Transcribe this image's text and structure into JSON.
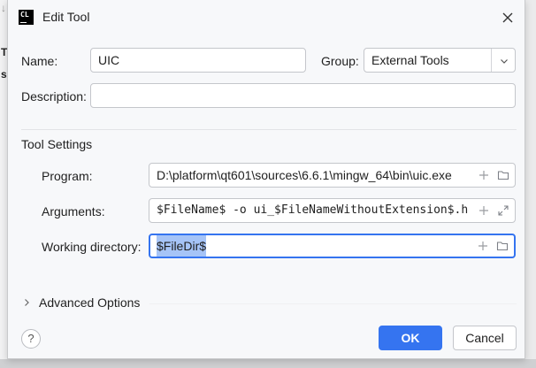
{
  "background": {
    "peek_texts": [
      "T",
      "si"
    ]
  },
  "dialog": {
    "title": "Edit Tool",
    "app_icon_text": "CL",
    "icons": {
      "close": "close-icon",
      "help": "help-icon",
      "add": "plus-icon",
      "browse": "folder-icon",
      "expand": "expand-icon",
      "dropdown": "chevron-down-icon",
      "advanced": "chevron-right-icon"
    }
  },
  "form": {
    "name_label": "Name:",
    "name_value": "UIC",
    "group_label": "Group:",
    "group_value": "External Tools",
    "description_label": "Description:",
    "description_value": ""
  },
  "tool_settings": {
    "section_label": "Tool Settings",
    "program_label": "Program:",
    "program_value": "D:\\platform\\qt601\\sources\\6.6.1\\mingw_64\\bin\\uic.exe",
    "arguments_label": "Arguments:",
    "arguments_value": "$FileName$ -o ui_$FileNameWithoutExtension$.h",
    "working_dir_label": "Working directory:",
    "working_dir_value": "$FileDir$"
  },
  "advanced": {
    "label": "Advanced Options"
  },
  "footer": {
    "help_label": "?",
    "ok_label": "OK",
    "cancel_label": "Cancel"
  },
  "colors": {
    "accent": "#3574f0",
    "selection": "#a6c4f7",
    "dialog_bg": "#f7f8fa"
  }
}
